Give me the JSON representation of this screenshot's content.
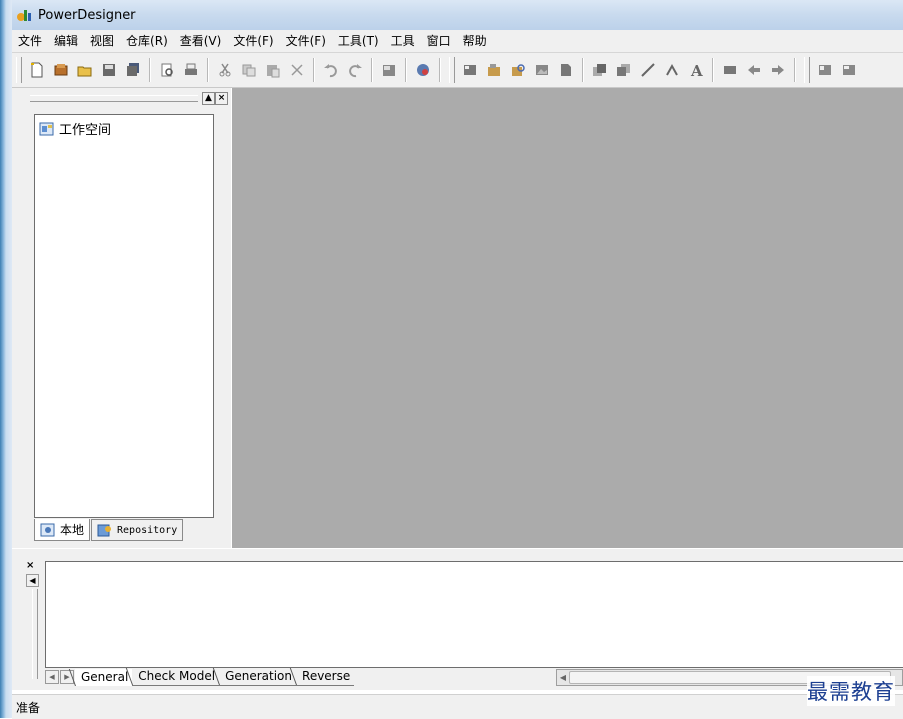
{
  "window": {
    "title": "PowerDesigner"
  },
  "menu": [
    "文件",
    "编辑",
    "视图",
    "仓库(R)",
    "查看(V)",
    "文件(F)",
    "文件(F)",
    "工具(T)",
    "工具",
    "窗口",
    "帮助"
  ],
  "toolbar_icons": [
    "new-icon",
    "model-icon",
    "open-icon",
    "save-icon",
    "save-all-icon",
    "|",
    "print-preview-icon",
    "print-icon",
    "|",
    "cut-icon",
    "copy-icon",
    "paste-icon",
    "delete-icon",
    "|",
    "undo-icon",
    "redo-icon",
    "|",
    "properties-icon",
    "|",
    "help-icon",
    "||",
    "diagram-icon",
    "package-icon",
    "package-find-icon",
    "image-icon",
    "page-icon",
    "|",
    "front-icon",
    "back-icon",
    "line-icon",
    "link-icon",
    "text-icon",
    "|",
    "align-icon",
    "left-arrow-icon",
    "right-arrow-icon",
    "||",
    "grid-icon",
    "grid2-icon"
  ],
  "browser": {
    "root_item": "工作空间",
    "tabs": [
      {
        "label": "本地",
        "icon": "local-icon"
      },
      {
        "label": "Repository",
        "icon": "repository-icon"
      }
    ]
  },
  "output": {
    "tabs": [
      "General",
      "Check Model",
      "Generation",
      "Reverse"
    ]
  },
  "status": {
    "text": "准备"
  },
  "watermark": "最需教育",
  "colors": {
    "workspace": "#ababab",
    "chrome": "#f0f0f0",
    "watermark": "#1c3f91"
  }
}
